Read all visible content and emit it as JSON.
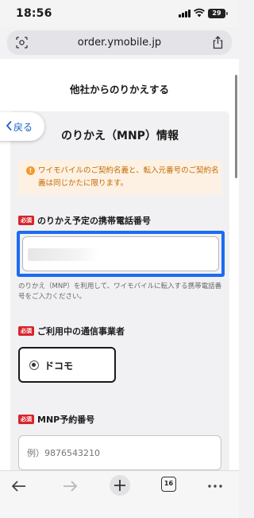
{
  "status_bar": {
    "time": "18:56",
    "battery": "29"
  },
  "browser": {
    "url": "order.ymobile.jp"
  },
  "page": {
    "section_title": "他社からのりかえする",
    "back_label": "戻る",
    "card_title": "のりかえ（MNP）情報",
    "notice": "ワイモバイルのご契約名義と、転入元番号のご契約名義は同じかたに限ります。",
    "required_badge": "必須",
    "phone_field": {
      "label": "のりかえ予定の携帯電話番号",
      "helper": "のりかえ（MNP）を利用して、ワイモバイルに転入する携帯電話番号をご入力ください。"
    },
    "carrier_field": {
      "label": "ご利用中の通信事業者",
      "selected": "ドコモ"
    },
    "mnp_field": {
      "label": "MNP予約番号",
      "placeholder": "例）9876543210"
    }
  },
  "toolbar": {
    "tab_count": "16"
  },
  "colors": {
    "accent_blue": "#1c6cf2",
    "required_red": "#d8242b",
    "notice_bg": "#fdf1e3",
    "notice_text": "#c46a00"
  }
}
